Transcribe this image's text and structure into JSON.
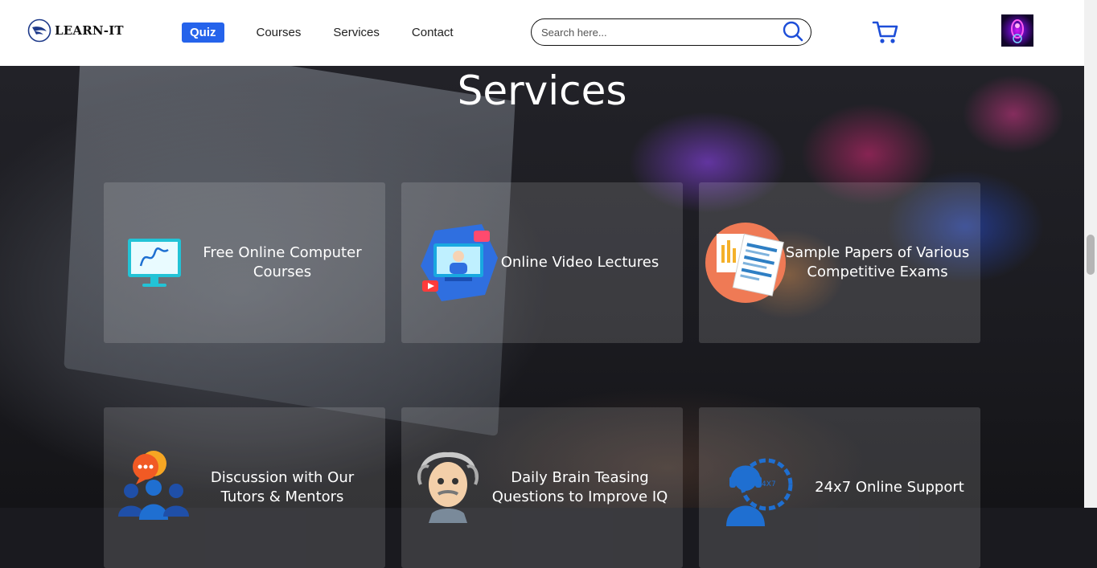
{
  "header": {
    "brand": "LEARN-IT",
    "nav": [
      {
        "label": "Quiz",
        "active": true
      },
      {
        "label": "Courses",
        "active": false
      },
      {
        "label": "Services",
        "active": false
      },
      {
        "label": "Contact",
        "active": false
      }
    ],
    "search": {
      "placeholder": "Search here...",
      "value": ""
    },
    "icons": {
      "search": "search-icon",
      "cart": "cart-icon",
      "logo": "feather-logo-icon"
    },
    "accent_color": "#2563eb",
    "cart_color": "#1d4ed8"
  },
  "main": {
    "title": "Services",
    "cards": [
      {
        "label": "Free Online Computer Courses",
        "icon": "monitor-icon"
      },
      {
        "label": "Online Video Lectures",
        "icon": "video-lecture-icon"
      },
      {
        "label": "Sample Papers of Various Competitive Exams",
        "icon": "papers-icon"
      },
      {
        "label": "Discussion with Our Tutors & Mentors",
        "icon": "discussion-icon"
      },
      {
        "label": "Daily Brain Teasing Questions to Improve IQ",
        "icon": "einstein-icon"
      },
      {
        "label": "24x7 Online Support",
        "icon": "support-headset-icon"
      }
    ]
  }
}
